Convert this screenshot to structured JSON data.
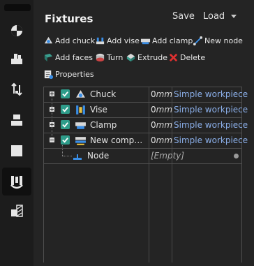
{
  "sidebar": {
    "buttons": [
      {
        "icon": "workpiece-icon"
      },
      {
        "icon": "stock-icon"
      },
      {
        "icon": "origin-icon"
      },
      {
        "icon": "setup-icon"
      },
      {
        "icon": "part-icon"
      },
      {
        "icon": "fixtures-icon",
        "active": true
      },
      {
        "icon": "pattern-icon"
      }
    ]
  },
  "header": {
    "title": "Fixtures",
    "save_label": "Save",
    "load_label": "Load"
  },
  "toolbar": {
    "add_chuck": "Add chuck",
    "add_vise": "Add vise",
    "add_clamp": "Add clamp",
    "new_node": "New node",
    "add_faces": "Add faces",
    "turn": "Turn",
    "extrude": "Extrude",
    "delete": "Delete",
    "properties": "Properties"
  },
  "tree": {
    "rows": [
      {
        "label": "Chuck",
        "value": "0",
        "unit": "mm",
        "link": "Simple workpiece",
        "expander": "+",
        "checked": true,
        "icon": "chuck-icon"
      },
      {
        "label": "Vise",
        "value": "0",
        "unit": "mm",
        "link": "Simple workpiece",
        "expander": "+",
        "checked": true,
        "icon": "vise-icon"
      },
      {
        "label": "Clamp",
        "value": "0",
        "unit": "mm",
        "link": "Simple workpiece",
        "expander": "+",
        "checked": true,
        "icon": "clamp-icon"
      },
      {
        "label": "New compon...",
        "value": "0",
        "unit": "mm",
        "link": "Simple workpiece",
        "expander": "−",
        "checked": true,
        "icon": "component-icon"
      }
    ],
    "child": {
      "label": "Node",
      "value": "[Empty]",
      "icon": "node-icon"
    }
  },
  "colors": {
    "background": "#242424",
    "sidebar": "#1c1c1c",
    "checkbox": "#2e9c8a",
    "link": "#8aaee8",
    "accent_blue": "#3a8ee6"
  }
}
